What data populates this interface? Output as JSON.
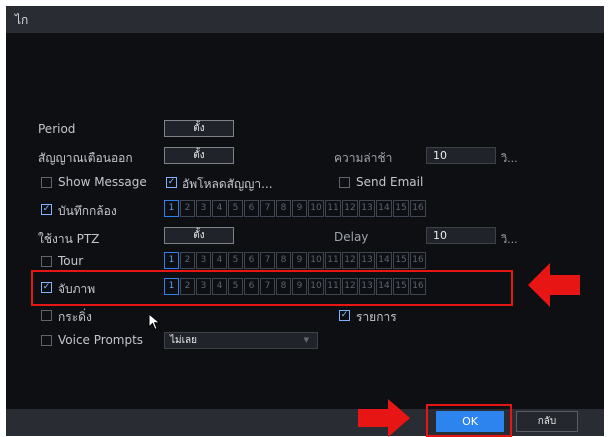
{
  "window": {
    "title": "ไก"
  },
  "rows": {
    "period": {
      "label": "Period",
      "button": "ตั้ง"
    },
    "alarm_out": {
      "label": "สัญญาณเตือนออก",
      "button": "ตั้ง",
      "delay_label": "ความล่าช้า",
      "delay_value": "10",
      "delay_unit": "วิ..."
    },
    "show_message": {
      "label": "Show Message",
      "checked": false,
      "upload_label": "อัพโหลดสัญญา...",
      "upload_checked": true,
      "send_email_label": "Send Email",
      "send_email_checked": false
    },
    "record": {
      "label": "บันทึกกล้อง",
      "checked": true
    },
    "ptz": {
      "label": "ใช้งาน PTZ",
      "button": "ตั้ง",
      "delay_label": "Delay",
      "delay_value": "10",
      "delay_unit": "วิ..."
    },
    "tour": {
      "label": "Tour",
      "checked": false
    },
    "snapshot": {
      "label": "จับภาพ",
      "checked": true
    },
    "buzzer": {
      "label": "กระดิ่ง",
      "checked": false,
      "log_label": "รายการ",
      "log_checked": true
    },
    "voice": {
      "label": "Voice Prompts",
      "checked": false,
      "select_value": "ไม่เลย"
    }
  },
  "channels": [
    "1",
    "2",
    "3",
    "4",
    "5",
    "6",
    "7",
    "8",
    "9",
    "10",
    "11",
    "12",
    "13",
    "14",
    "15",
    "16"
  ],
  "footer": {
    "ok": "OK",
    "back": "กลับ"
  },
  "colors": {
    "accent": "#2e84ee",
    "highlight": "#e81515",
    "background": "#0d0f13"
  }
}
